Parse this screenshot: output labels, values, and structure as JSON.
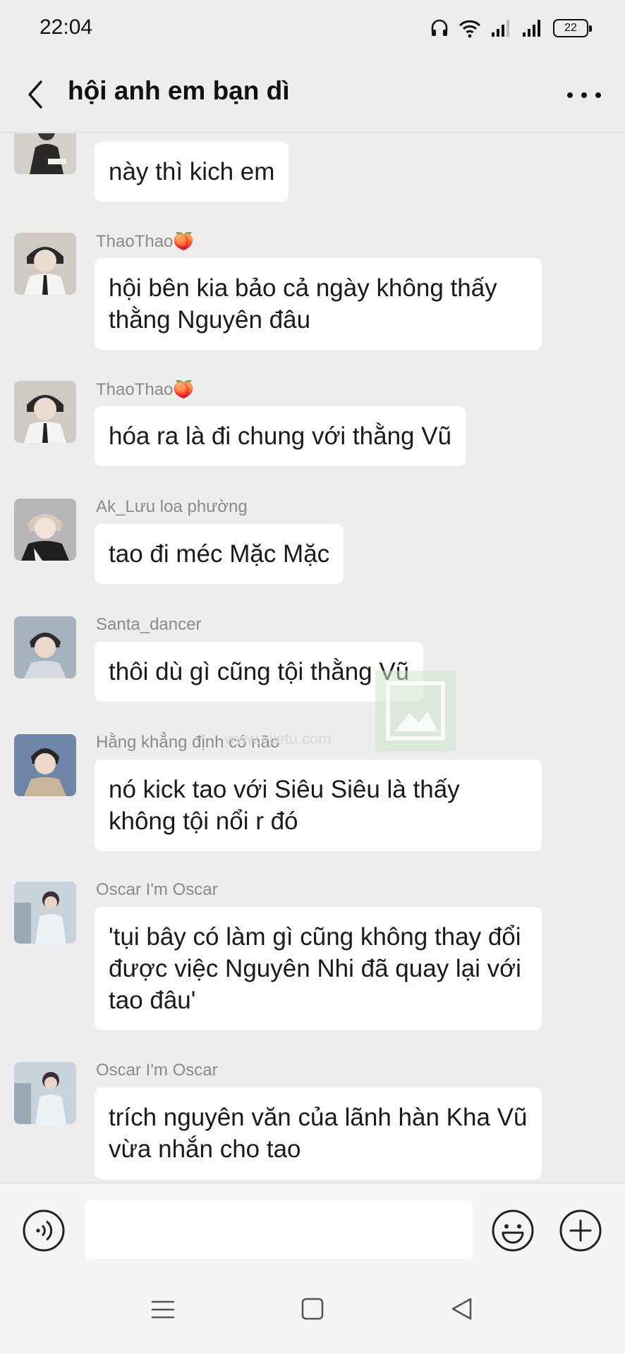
{
  "status_bar": {
    "time": "22:04",
    "battery": "22",
    "icons": [
      "headphones-icon",
      "wifi-icon",
      "signal-icon",
      "signal-icon",
      "battery-icon"
    ]
  },
  "header": {
    "title": "hội anh em bạn dì"
  },
  "messages": [
    {
      "sender": "",
      "text": "này thì kich em",
      "avatar_color": "#c9c4bf"
    },
    {
      "sender": "ThaoThao🍑",
      "text": "hội bên kia bảo cả ngày không thấy thằng Nguyên đâu",
      "avatar_color": "#bdb7b0"
    },
    {
      "sender": "ThaoThao🍑",
      "text": "hóa ra là đi chung với thằng Vũ",
      "avatar_color": "#bdb7b0"
    },
    {
      "sender": "Ak_Lưu loa phường",
      "text": "tao đi méc Mặc Mặc",
      "avatar_color": "#a9a6a8"
    },
    {
      "sender": "Santa_dancer",
      "text": "thôi dù gì cũng tội thằng Vũ",
      "avatar_color": "#8f9aa8"
    },
    {
      "sender": "Hằng khẳng định có não",
      "text": "nó kick tao với Siêu Siêu là thấy không tội nổi r đó",
      "avatar_color": "#7f8ea6"
    },
    {
      "sender": "Oscar I'm Oscar",
      "text": "'tụi bây có làm gì cũng không thay đổi được việc Nguyên Nhi đã quay lại với tao đâu'",
      "avatar_color": "#9fb0bf"
    },
    {
      "sender": "Oscar I'm Oscar",
      "text": "trích nguyên văn của lãnh hàn Kha Vũ vừa nhắn cho tao",
      "avatar_color": "#9fb0bf"
    }
  ],
  "watermark": {
    "text": "www.vjietu.com"
  },
  "input": {
    "value": "",
    "placeholder": ""
  }
}
